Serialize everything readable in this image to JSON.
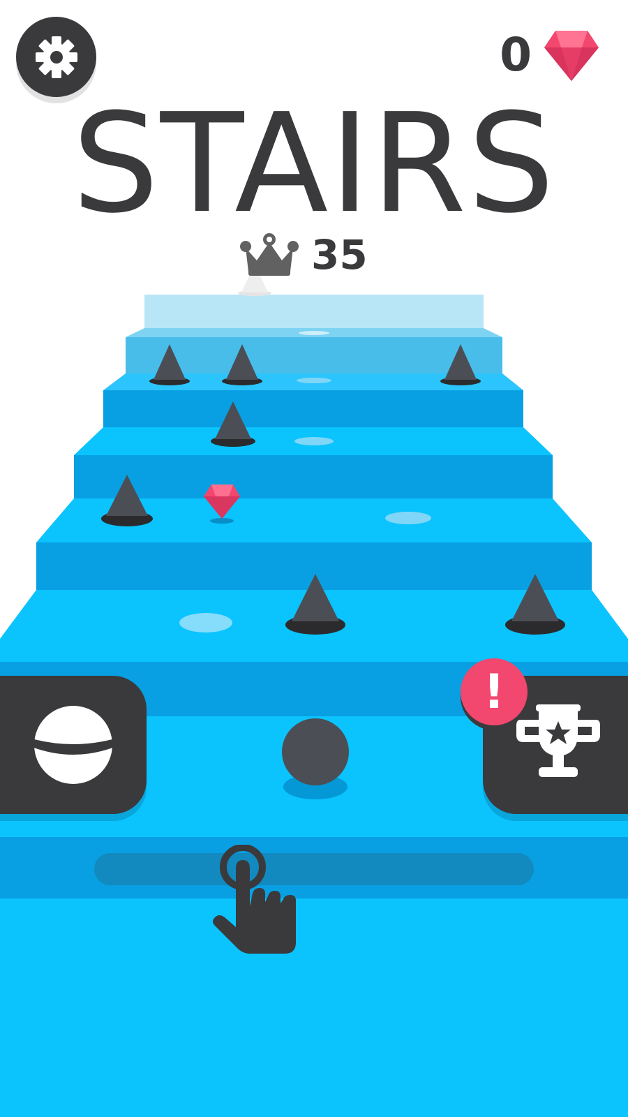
{
  "header": {
    "gem_count": "0",
    "title": "STAIRS",
    "best_score": "35"
  },
  "icons": {
    "settings": "gear-icon",
    "gems": "gem-icon",
    "best": "crown-icon",
    "skins": "ball-skin-icon",
    "trophy": "trophy-icon",
    "alert": "exclamation-icon",
    "tutorial": "tap-hand-icon"
  },
  "controls": {
    "alert_text": "!"
  },
  "colors": {
    "dark": "#3a3a3c",
    "stair_top": "#0bc3fd",
    "stair_front": "#08a0e2",
    "gem": "#f2476e",
    "badge": "#f2476e",
    "background": "#ffffff"
  }
}
